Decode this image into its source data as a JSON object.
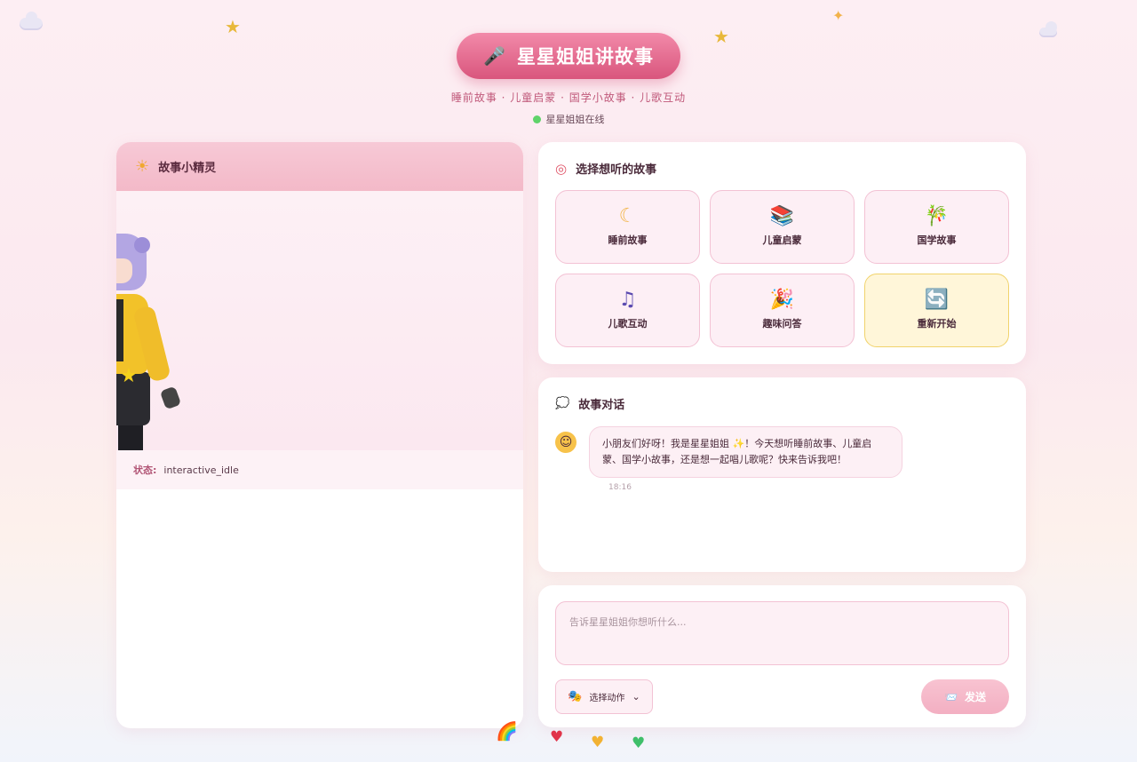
{
  "header": {
    "title": "星星姐姐讲故事",
    "subtitle": "睡前故事 · 儿童启蒙 · 国学小故事 · 儿歌互动",
    "online_status": "星星姐姐在线"
  },
  "left_panel": {
    "title": "故事小精灵",
    "status_label": "状态:",
    "status_value": "interactive_idle"
  },
  "stories": {
    "title": "选择想听的故事",
    "items": [
      {
        "label": "睡前故事",
        "icon": "moon-icon"
      },
      {
        "label": "儿童启蒙",
        "icon": "books-icon"
      },
      {
        "label": "国学故事",
        "icon": "bamboo-icon"
      },
      {
        "label": "儿歌互动",
        "icon": "music-note-icon"
      },
      {
        "label": "趣味问答",
        "icon": "party-popper-icon"
      },
      {
        "label": "重新开始",
        "icon": "refresh-icon"
      }
    ]
  },
  "chat": {
    "title": "故事对话",
    "messages": [
      {
        "text": "小朋友们好呀！我是星星姐姐 ✨！今天想听睡前故事、儿童启蒙、国学小故事，还是想一起唱儿歌呢？快来告诉我吧！",
        "time": "18:16"
      }
    ]
  },
  "composer": {
    "placeholder": "告诉星星姐姐你想听什么...",
    "action_label": "选择动作",
    "send_label": "发送"
  },
  "colors": {
    "accent": "#d9567d",
    "pink_light": "#fdeff5",
    "online": "#5fd36a"
  }
}
